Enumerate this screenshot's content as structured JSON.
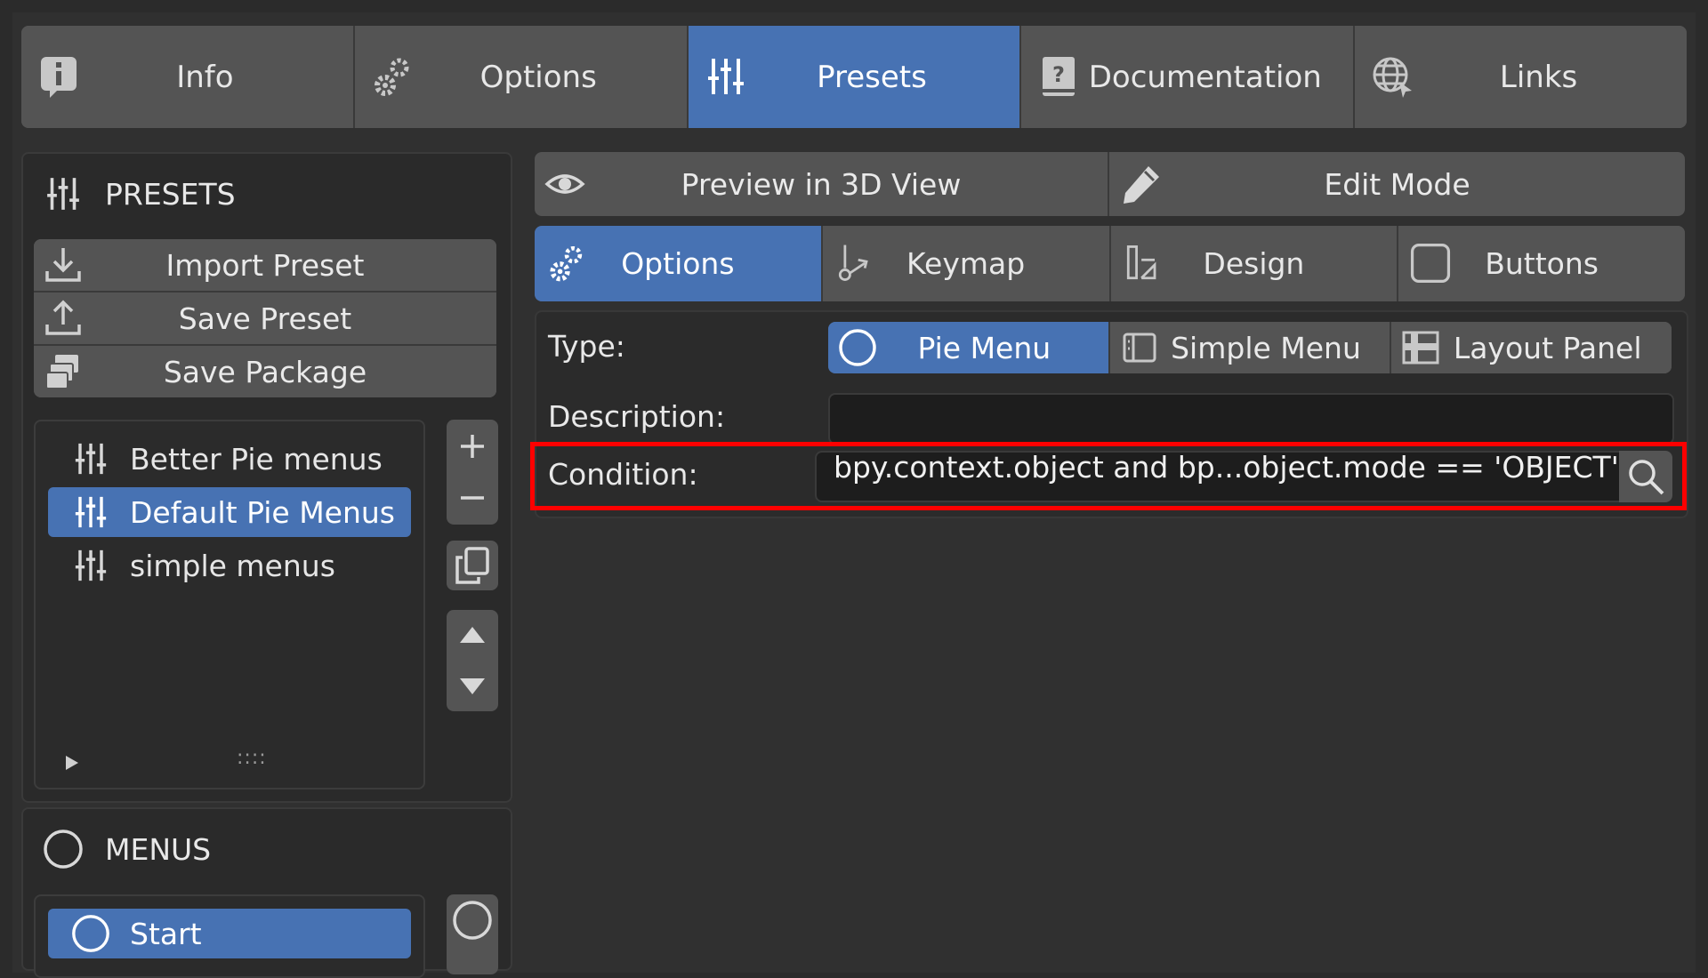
{
  "top_tabs": [
    {
      "label": "Info",
      "icon": "info-icon",
      "active": false
    },
    {
      "label": "Options",
      "icon": "gears-icon",
      "active": false
    },
    {
      "label": "Presets",
      "icon": "sliders-icon",
      "active": true
    },
    {
      "label": "Documentation",
      "icon": "help-book-icon",
      "active": false
    },
    {
      "label": "Links",
      "icon": "globe-icon",
      "active": false
    }
  ],
  "presets_panel": {
    "title": "PRESETS",
    "import_label": "Import Preset",
    "save_label": "Save Preset",
    "package_label": "Save Package",
    "items": [
      {
        "label": "Better Pie menus",
        "selected": false
      },
      {
        "label": "Default Pie Menus",
        "selected": true
      },
      {
        "label": "simple menus",
        "selected": false
      }
    ],
    "grip": "::::"
  },
  "menus_panel": {
    "title": "MENUS",
    "items": [
      {
        "label": "Start",
        "selected": true
      }
    ]
  },
  "toolbar": {
    "preview_label": "Preview in 3D View",
    "edit_label": "Edit Mode"
  },
  "sub_tabs": [
    {
      "label": "Options",
      "icon": "gears-icon",
      "active": true
    },
    {
      "label": "Keymap",
      "icon": "keymap-icon",
      "active": false
    },
    {
      "label": "Design",
      "icon": "design-icon",
      "active": false
    },
    {
      "label": "Buttons",
      "icon": "buttons-icon",
      "active": false
    }
  ],
  "form": {
    "type_label": "Type:",
    "type_options": [
      {
        "label": "Pie Menu",
        "active": true
      },
      {
        "label": "Simple Menu",
        "active": false
      },
      {
        "label": "Layout Panel",
        "active": false
      }
    ],
    "description_label": "Description:",
    "description_value": "",
    "condition_label": "Condition:",
    "condition_value": "bpy.context.object and bp...object.mode == 'OBJECT'"
  },
  "colors": {
    "accent": "#4772b3",
    "highlight_box": "#ff0000",
    "button": "#545454",
    "background": "#303030"
  }
}
